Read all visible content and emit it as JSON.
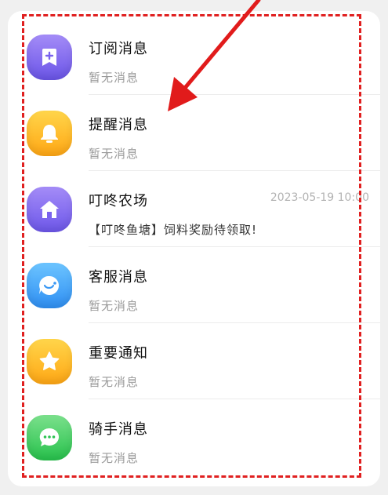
{
  "messages": [
    {
      "title": "订阅消息",
      "subtitle": "暂无消息",
      "time": "",
      "icon": "bookmark-plus-icon",
      "color_top": "#a48cf7",
      "color_bottom": "#6b55e8"
    },
    {
      "title": "提醒消息",
      "subtitle": "暂无消息",
      "time": "",
      "icon": "bell-icon",
      "color_top": "#ffd54a",
      "color_bottom": "#ffa715"
    },
    {
      "title": "叮咚农场",
      "subtitle": "【叮咚鱼塘】饲料奖励待领取!",
      "time": "2023-05-19 10:00",
      "icon": "house-icon",
      "color_top": "#a48cf7",
      "color_bottom": "#6d57ea"
    },
    {
      "title": "客服消息",
      "subtitle": "暂无消息",
      "time": "",
      "icon": "chat-bubble-icon",
      "color_top": "#6cc4ff",
      "color_bottom": "#2f8ff3"
    },
    {
      "title": "重要通知",
      "subtitle": "暂无消息",
      "time": "",
      "icon": "star-icon",
      "color_top": "#ffd54a",
      "color_bottom": "#ffa715"
    },
    {
      "title": "骑手消息",
      "subtitle": "暂无消息",
      "time": "",
      "icon": "message-dots-icon",
      "color_top": "#7be08c",
      "color_bottom": "#27c24c"
    }
  ],
  "annotation": {
    "frame_color": "#e02020"
  }
}
